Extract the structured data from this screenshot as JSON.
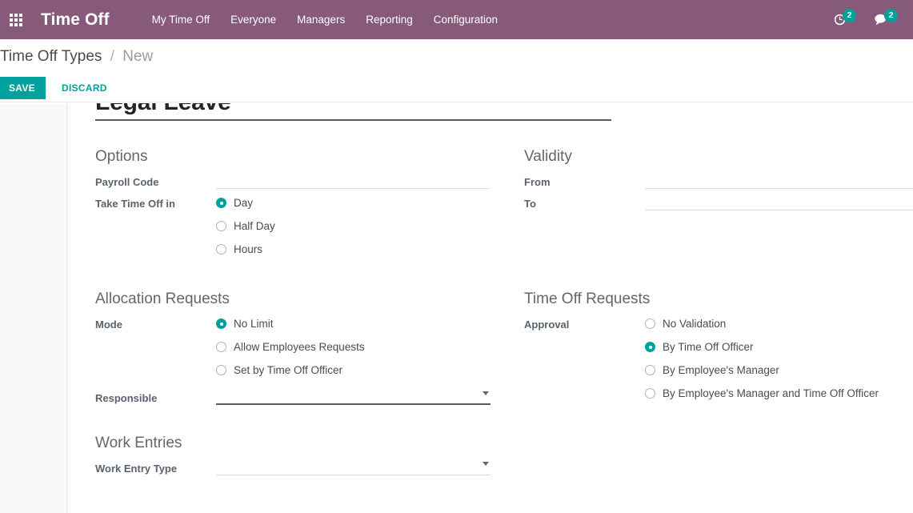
{
  "navbar": {
    "apps_icon": "apps-grid-icon",
    "brand": "Time Off",
    "menu": [
      {
        "label": "My Time Off"
      },
      {
        "label": "Everyone"
      },
      {
        "label": "Managers"
      },
      {
        "label": "Reporting"
      },
      {
        "label": "Configuration"
      }
    ],
    "systray": [
      {
        "icon": "clock-icon",
        "count": "2"
      },
      {
        "icon": "chat-bubble-icon",
        "count": "2"
      }
    ],
    "bg_color": "#875a7b"
  },
  "control_panel": {
    "breadcrumb": {
      "root": "Time Off Types",
      "separator": "/",
      "current": "New"
    },
    "save_label": "SAVE",
    "discard_label": "DISCARD",
    "save_color": "#00a09d"
  },
  "form": {
    "title_value": "Legal Leave",
    "title_placeholder": "Time Off Type",
    "groups": {
      "options": {
        "title": "Options",
        "payroll_code": {
          "label": "Payroll Code",
          "value": "",
          "placeholder": ""
        },
        "take_time_off_in": {
          "label": "Take Time Off in",
          "selected": "Day",
          "options": [
            {
              "label": "Day",
              "checked": true
            },
            {
              "label": "Half Day",
              "checked": false
            },
            {
              "label": "Hours",
              "checked": false
            }
          ]
        }
      },
      "validity": {
        "title": "Validity",
        "from": {
          "label": "From",
          "value": "",
          "placeholder": ""
        },
        "to": {
          "label": "To",
          "value": "",
          "placeholder": ""
        }
      },
      "allocation_requests": {
        "title": "Allocation Requests",
        "mode": {
          "label": "Mode",
          "selected": "No Limit",
          "options": [
            {
              "label": "No Limit",
              "checked": true
            },
            {
              "label": "Allow Employees Requests",
              "checked": false
            },
            {
              "label": "Set by Time Off Officer",
              "checked": false
            }
          ]
        },
        "responsible": {
          "label": "Responsible",
          "value": "",
          "placeholder": "",
          "focused": true
        }
      },
      "time_off_requests": {
        "title": "Time Off Requests",
        "approval": {
          "label": "Approval",
          "selected": "By Time Off Officer",
          "options": [
            {
              "label": "No Validation",
              "checked": false
            },
            {
              "label": "By Time Off Officer",
              "checked": true
            },
            {
              "label": "By Employee's Manager",
              "checked": false
            },
            {
              "label": "By Employee's Manager and Time Off Officer",
              "checked": false
            }
          ]
        }
      },
      "work_entries": {
        "title": "Work Entries",
        "work_entry_type": {
          "label": "Work Entry Type",
          "value": "",
          "placeholder": ""
        }
      }
    }
  },
  "theme": {
    "accent": "#00a09d",
    "brand_purple": "#875a7b",
    "label_gray": "#59626d",
    "heading_gray": "#666666"
  }
}
